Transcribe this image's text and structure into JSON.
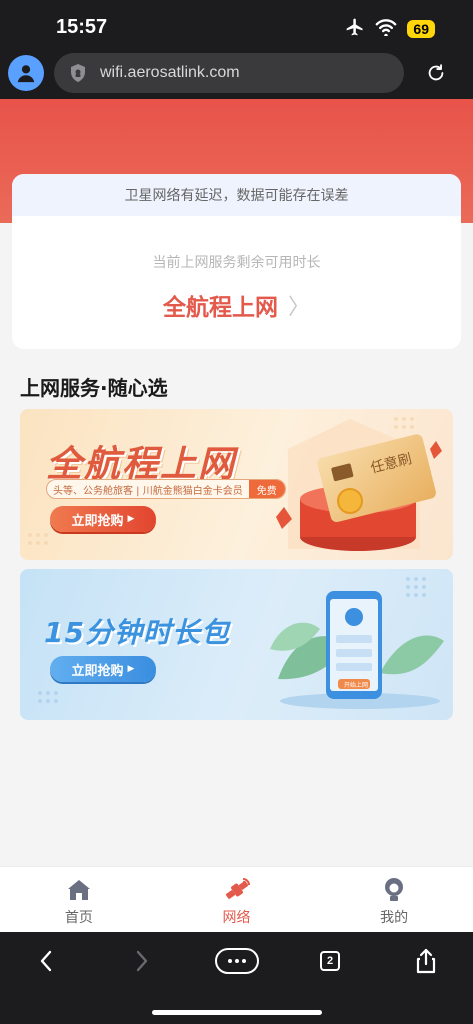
{
  "status_bar": {
    "time": "15:57",
    "battery": "69"
  },
  "browser": {
    "url": "wifi.aerosatlink.com",
    "tab_count": "2"
  },
  "notice": {
    "message": "卫星网络有延迟，数据可能存在误差"
  },
  "remaining": {
    "label": "当前上网服务剩余可用时长",
    "value": "全航程上网",
    "chevron": "〉"
  },
  "section": {
    "title": "上网服务·随心选"
  },
  "banners": [
    {
      "title": "全航程上网",
      "tag": "头等、公务舱旅客 | 川航金熊猫白金卡会员",
      "tag_badge": "免费",
      "button": "立即抢购",
      "card_text": "任意刷"
    },
    {
      "title": "15分钟时长包",
      "button": "立即抢购",
      "phone_button": "开始上网"
    }
  ],
  "bottom_nav": [
    {
      "label": "首页",
      "icon": "home-icon"
    },
    {
      "label": "网络",
      "icon": "satellite-icon",
      "active": true
    },
    {
      "label": "我的",
      "icon": "profile-icon"
    }
  ],
  "colors": {
    "accent": "#e35a4d",
    "header_red": "#e8534a",
    "blue": "#3b93e0"
  }
}
